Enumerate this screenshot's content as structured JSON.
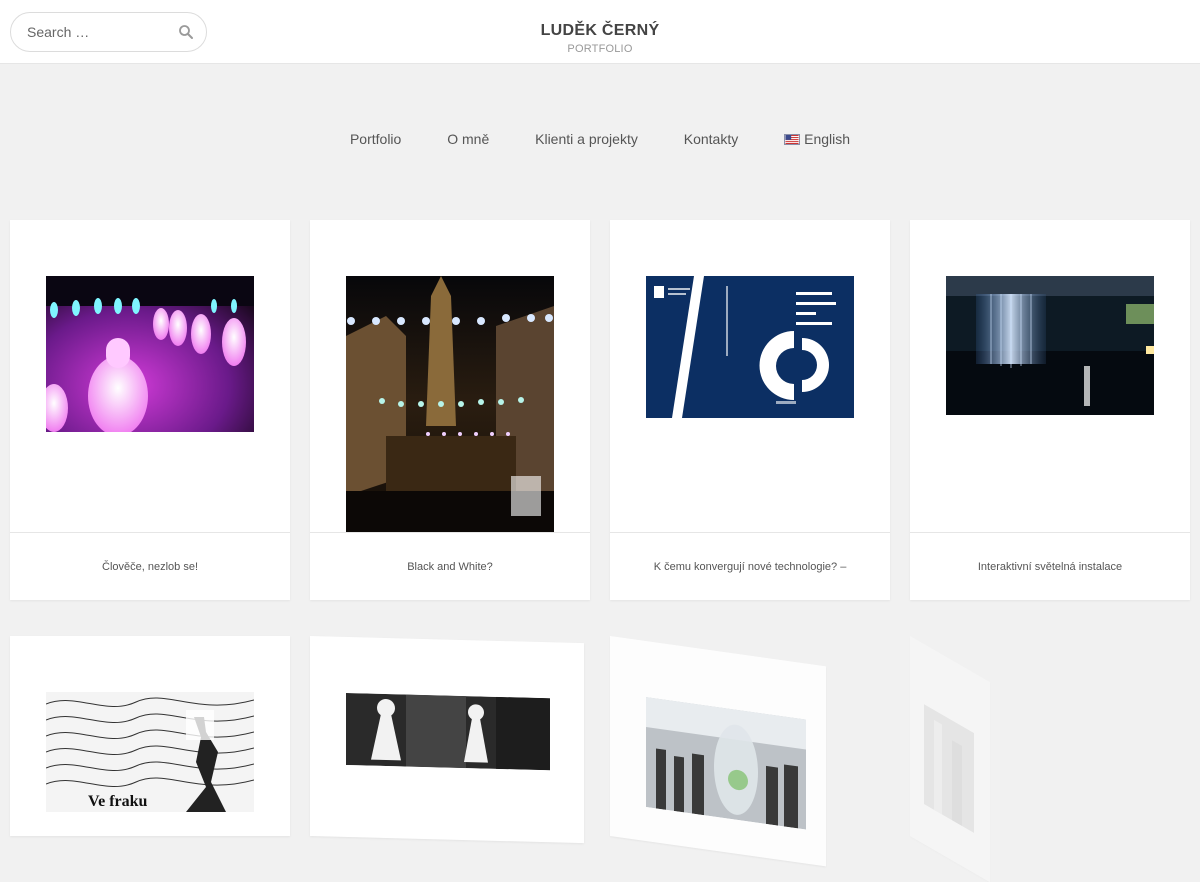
{
  "header": {
    "site_title": "LUDĚK ČERNÝ",
    "site_subtitle": "PORTFOLIO",
    "search_placeholder": "Search …",
    "search_icon": "search-icon"
  },
  "nav": {
    "items": [
      {
        "label": "Portfolio"
      },
      {
        "label": "O mně"
      },
      {
        "label": "Klienti a projekty"
      },
      {
        "label": "Kontakty"
      },
      {
        "label": "English",
        "icon": "us-flag-icon"
      }
    ]
  },
  "colors": {
    "background": "#f1f1f1",
    "card": "#ffffff",
    "text": "#555555",
    "title": "#444444"
  },
  "cards": [
    {
      "caption": "Člověče, nezlob se!"
    },
    {
      "caption": "Black and White?"
    },
    {
      "caption": "K čemu konvergují nové technologie? –"
    },
    {
      "caption": "Interaktivní světelná instalace"
    }
  ],
  "thumbnail_texts": {
    "book_title": "K čemu konvergují nové technologie?",
    "poster_title": "Ve fraku"
  }
}
